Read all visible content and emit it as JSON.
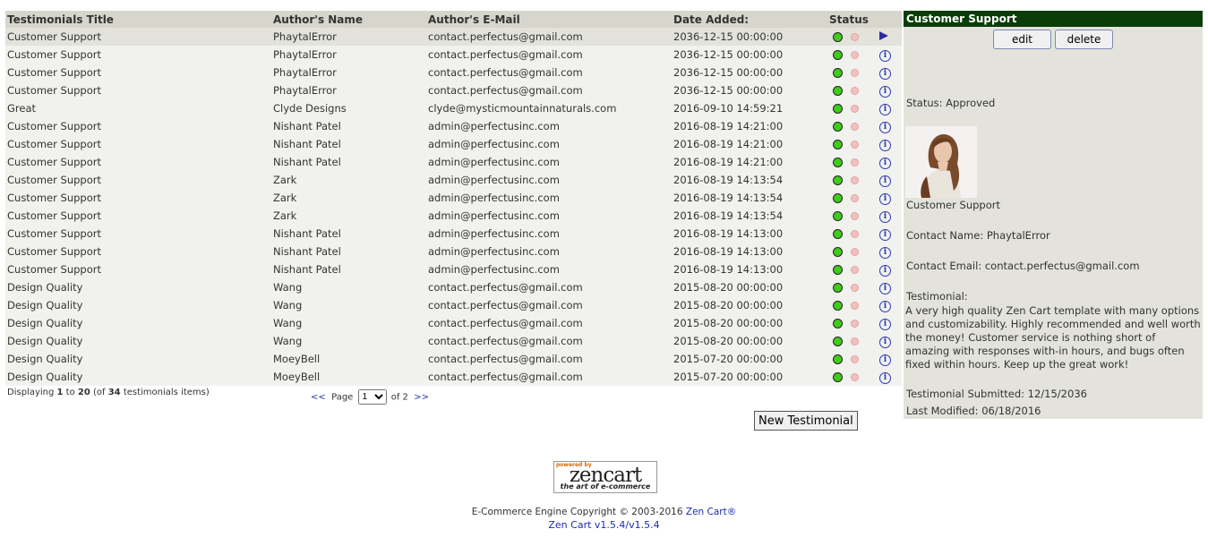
{
  "columns": [
    "Testimonials Title",
    "Author's Name",
    "Author's E-Mail",
    "Date Added:",
    "Status"
  ],
  "rows": [
    {
      "title": "Customer Support",
      "author": "PhaytalError",
      "email": "contact.perfectus@gmail.com",
      "date": "2036-12-15 00:00:00",
      "selected": true
    },
    {
      "title": "Customer Support",
      "author": "PhaytalError",
      "email": "contact.perfectus@gmail.com",
      "date": "2036-12-15 00:00:00"
    },
    {
      "title": "Customer Support",
      "author": "PhaytalError",
      "email": "contact.perfectus@gmail.com",
      "date": "2036-12-15 00:00:00"
    },
    {
      "title": "Customer Support",
      "author": "PhaytalError",
      "email": "contact.perfectus@gmail.com",
      "date": "2036-12-15 00:00:00"
    },
    {
      "title": "Great",
      "author": "Clyde Designs",
      "email": "clyde@mysticmountainnaturals.com",
      "date": "2016-09-10 14:59:21"
    },
    {
      "title": "Customer Support",
      "author": "Nishant Patel",
      "email": "admin@perfectusinc.com",
      "date": "2016-08-19 14:21:00"
    },
    {
      "title": "Customer Support",
      "author": "Nishant Patel",
      "email": "admin@perfectusinc.com",
      "date": "2016-08-19 14:21:00"
    },
    {
      "title": "Customer Support",
      "author": "Nishant Patel",
      "email": "admin@perfectusinc.com",
      "date": "2016-08-19 14:21:00"
    },
    {
      "title": "Customer Support",
      "author": "Zark",
      "email": "admin@perfectusinc.com",
      "date": "2016-08-19 14:13:54"
    },
    {
      "title": "Customer Support",
      "author": "Zark",
      "email": "admin@perfectusinc.com",
      "date": "2016-08-19 14:13:54"
    },
    {
      "title": "Customer Support",
      "author": "Zark",
      "email": "admin@perfectusinc.com",
      "date": "2016-08-19 14:13:54"
    },
    {
      "title": "Customer Support",
      "author": "Nishant Patel",
      "email": "admin@perfectusinc.com",
      "date": "2016-08-19 14:13:00"
    },
    {
      "title": "Customer Support",
      "author": "Nishant Patel",
      "email": "admin@perfectusinc.com",
      "date": "2016-08-19 14:13:00"
    },
    {
      "title": "Customer Support",
      "author": "Nishant Patel",
      "email": "admin@perfectusinc.com",
      "date": "2016-08-19 14:13:00"
    },
    {
      "title": "Design Quality",
      "author": "Wang",
      "email": "contact.perfectus@gmail.com",
      "date": "2015-08-20 00:00:00"
    },
    {
      "title": "Design Quality",
      "author": "Wang",
      "email": "contact.perfectus@gmail.com",
      "date": "2015-08-20 00:00:00"
    },
    {
      "title": "Design Quality",
      "author": "Wang",
      "email": "contact.perfectus@gmail.com",
      "date": "2015-08-20 00:00:00"
    },
    {
      "title": "Design Quality",
      "author": "Wang",
      "email": "contact.perfectus@gmail.com",
      "date": "2015-08-20 00:00:00"
    },
    {
      "title": "Design Quality",
      "author": "MoeyBell",
      "email": "contact.perfectus@gmail.com",
      "date": "2015-07-20 00:00:00"
    },
    {
      "title": "Design Quality",
      "author": "MoeyBell",
      "email": "contact.perfectus@gmail.com",
      "date": "2015-07-20 00:00:00"
    }
  ],
  "pagination": {
    "displaying_prefix": "Displaying ",
    "from": "1",
    "to_word": " to ",
    "to": "20",
    "of_prefix": " (of ",
    "total": "34",
    "suffix": " testimonials items)",
    "prev": "<<",
    "page_label": "Page",
    "page_value": "1",
    "of_label": "of 2",
    "next": ">>"
  },
  "new_button_label": "New Testimonial",
  "sidebar": {
    "title": "Customer Support",
    "edit_label": "edit",
    "delete_label": "delete",
    "status": "Status: Approved",
    "caption": "Customer Support",
    "contact_name": "Contact Name: PhaytalError",
    "contact_email": "Contact Email: contact.perfectus@gmail.com",
    "testimonial_label": "Testimonial:",
    "testimonial_text": "A very high quality Zen Cart template with many options and customizability. Highly recommended and well worth the money! Customer service is nothing short of amazing with responses with-in hours, and bugs often fixed within hours. Keep up the great work!",
    "submitted": "Testimonial Submitted: 12/15/2036",
    "modified": "Last Modified: 06/18/2016"
  },
  "footer": {
    "logo_powered": "powered by",
    "logo_name": "zencart",
    "logo_tagline": "the art of e-commerce",
    "copyright_prefix": "E-Commerce Engine Copyright © 2003-2016 ",
    "copyright_link": "Zen Cart®",
    "version": "Zen Cart v1.5.4/v1.5.4"
  },
  "colors": {
    "sidebar_header": "#0b3d08",
    "status_on": "#3fcc1a",
    "status_off": "#f3c0c0",
    "link": "#1a2bb5"
  },
  "icons": {
    "status_on": "green-dot-icon",
    "status_off": "red-dot-icon",
    "info": "info-icon",
    "selected": "arrow-right-icon"
  }
}
